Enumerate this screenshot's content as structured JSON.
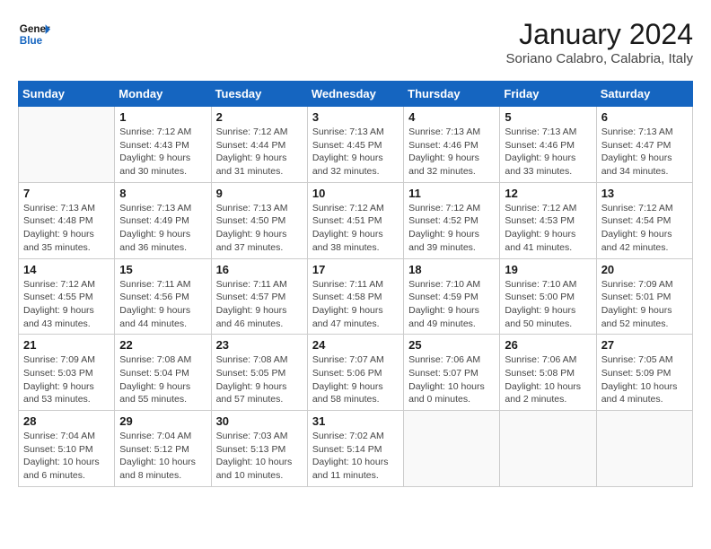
{
  "header": {
    "logo_general": "General",
    "logo_blue": "Blue",
    "month_title": "January 2024",
    "subtitle": "Soriano Calabro, Calabria, Italy"
  },
  "weekdays": [
    "Sunday",
    "Monday",
    "Tuesday",
    "Wednesday",
    "Thursday",
    "Friday",
    "Saturday"
  ],
  "weeks": [
    [
      {
        "day": "",
        "sunrise": "",
        "sunset": "",
        "daylight": ""
      },
      {
        "day": "1",
        "sunrise": "7:12 AM",
        "sunset": "4:43 PM",
        "daylight": "9 hours and 30 minutes."
      },
      {
        "day": "2",
        "sunrise": "7:12 AM",
        "sunset": "4:44 PM",
        "daylight": "9 hours and 31 minutes."
      },
      {
        "day": "3",
        "sunrise": "7:13 AM",
        "sunset": "4:45 PM",
        "daylight": "9 hours and 32 minutes."
      },
      {
        "day": "4",
        "sunrise": "7:13 AM",
        "sunset": "4:46 PM",
        "daylight": "9 hours and 32 minutes."
      },
      {
        "day": "5",
        "sunrise": "7:13 AM",
        "sunset": "4:46 PM",
        "daylight": "9 hours and 33 minutes."
      },
      {
        "day": "6",
        "sunrise": "7:13 AM",
        "sunset": "4:47 PM",
        "daylight": "9 hours and 34 minutes."
      }
    ],
    [
      {
        "day": "7",
        "sunrise": "7:13 AM",
        "sunset": "4:48 PM",
        "daylight": "9 hours and 35 minutes."
      },
      {
        "day": "8",
        "sunrise": "7:13 AM",
        "sunset": "4:49 PM",
        "daylight": "9 hours and 36 minutes."
      },
      {
        "day": "9",
        "sunrise": "7:13 AM",
        "sunset": "4:50 PM",
        "daylight": "9 hours and 37 minutes."
      },
      {
        "day": "10",
        "sunrise": "7:12 AM",
        "sunset": "4:51 PM",
        "daylight": "9 hours and 38 minutes."
      },
      {
        "day": "11",
        "sunrise": "7:12 AM",
        "sunset": "4:52 PM",
        "daylight": "9 hours and 39 minutes."
      },
      {
        "day": "12",
        "sunrise": "7:12 AM",
        "sunset": "4:53 PM",
        "daylight": "9 hours and 41 minutes."
      },
      {
        "day": "13",
        "sunrise": "7:12 AM",
        "sunset": "4:54 PM",
        "daylight": "9 hours and 42 minutes."
      }
    ],
    [
      {
        "day": "14",
        "sunrise": "7:12 AM",
        "sunset": "4:55 PM",
        "daylight": "9 hours and 43 minutes."
      },
      {
        "day": "15",
        "sunrise": "7:11 AM",
        "sunset": "4:56 PM",
        "daylight": "9 hours and 44 minutes."
      },
      {
        "day": "16",
        "sunrise": "7:11 AM",
        "sunset": "4:57 PM",
        "daylight": "9 hours and 46 minutes."
      },
      {
        "day": "17",
        "sunrise": "7:11 AM",
        "sunset": "4:58 PM",
        "daylight": "9 hours and 47 minutes."
      },
      {
        "day": "18",
        "sunrise": "7:10 AM",
        "sunset": "4:59 PM",
        "daylight": "9 hours and 49 minutes."
      },
      {
        "day": "19",
        "sunrise": "7:10 AM",
        "sunset": "5:00 PM",
        "daylight": "9 hours and 50 minutes."
      },
      {
        "day": "20",
        "sunrise": "7:09 AM",
        "sunset": "5:01 PM",
        "daylight": "9 hours and 52 minutes."
      }
    ],
    [
      {
        "day": "21",
        "sunrise": "7:09 AM",
        "sunset": "5:03 PM",
        "daylight": "9 hours and 53 minutes."
      },
      {
        "day": "22",
        "sunrise": "7:08 AM",
        "sunset": "5:04 PM",
        "daylight": "9 hours and 55 minutes."
      },
      {
        "day": "23",
        "sunrise": "7:08 AM",
        "sunset": "5:05 PM",
        "daylight": "9 hours and 57 minutes."
      },
      {
        "day": "24",
        "sunrise": "7:07 AM",
        "sunset": "5:06 PM",
        "daylight": "9 hours and 58 minutes."
      },
      {
        "day": "25",
        "sunrise": "7:06 AM",
        "sunset": "5:07 PM",
        "daylight": "10 hours and 0 minutes."
      },
      {
        "day": "26",
        "sunrise": "7:06 AM",
        "sunset": "5:08 PM",
        "daylight": "10 hours and 2 minutes."
      },
      {
        "day": "27",
        "sunrise": "7:05 AM",
        "sunset": "5:09 PM",
        "daylight": "10 hours and 4 minutes."
      }
    ],
    [
      {
        "day": "28",
        "sunrise": "7:04 AM",
        "sunset": "5:10 PM",
        "daylight": "10 hours and 6 minutes."
      },
      {
        "day": "29",
        "sunrise": "7:04 AM",
        "sunset": "5:12 PM",
        "daylight": "10 hours and 8 minutes."
      },
      {
        "day": "30",
        "sunrise": "7:03 AM",
        "sunset": "5:13 PM",
        "daylight": "10 hours and 10 minutes."
      },
      {
        "day": "31",
        "sunrise": "7:02 AM",
        "sunset": "5:14 PM",
        "daylight": "10 hours and 11 minutes."
      },
      {
        "day": "",
        "sunrise": "",
        "sunset": "",
        "daylight": ""
      },
      {
        "day": "",
        "sunrise": "",
        "sunset": "",
        "daylight": ""
      },
      {
        "day": "",
        "sunrise": "",
        "sunset": "",
        "daylight": ""
      }
    ]
  ],
  "labels": {
    "sunrise": "Sunrise:",
    "sunset": "Sunset:",
    "daylight": "Daylight:"
  }
}
